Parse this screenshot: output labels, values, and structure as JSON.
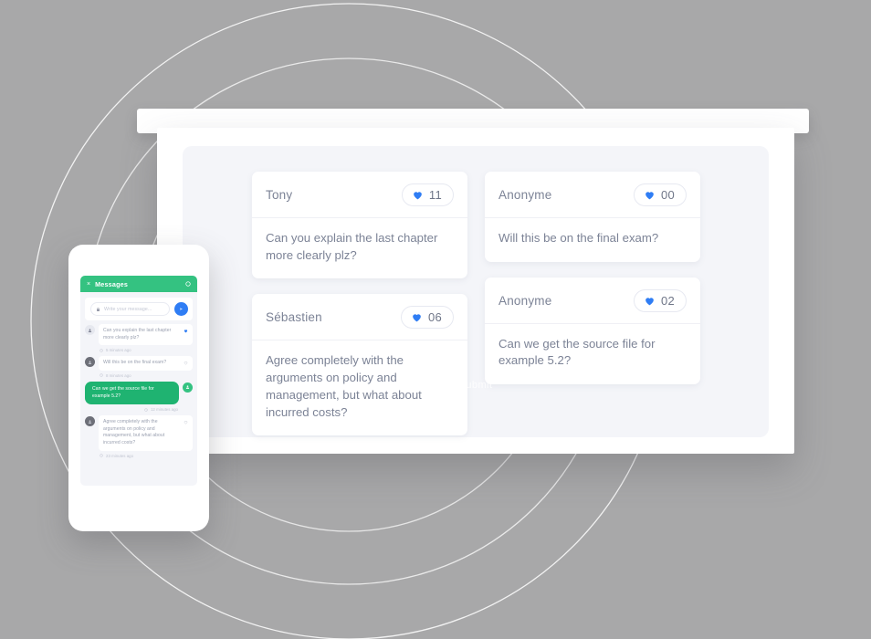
{
  "theme": {
    "background": "#a8a8a9",
    "panel_background": "#f4f5f9",
    "card_background": "#ffffff",
    "accent_blue": "#2f7df4",
    "accent_green": "#34c281",
    "bubble_green": "#1fb371",
    "text_muted": "#7c8396"
  },
  "board": {
    "submit_label": "Submit",
    "columns": [
      {
        "cards": [
          {
            "author": "Tony",
            "likes": "11",
            "message": "Can you explain the last chapter more clearly plz?"
          },
          {
            "author": "Sébastien",
            "likes": "06",
            "message": "Agree completely with the arguments on policy and management, but what about incurred costs?"
          }
        ]
      },
      {
        "cards": [
          {
            "author": "Anonyme",
            "likes": "00",
            "message": "Will this be on the final exam?"
          },
          {
            "author": "Anonyme",
            "likes": "02",
            "message": "Can we get the source file for example 5.2?"
          }
        ]
      }
    ]
  },
  "phone": {
    "header": {
      "close_label": "×",
      "title": "Messages",
      "settings_icon": "gear-icon"
    },
    "composer": {
      "placeholder": "Write your message...",
      "lock_icon": "lock-icon",
      "send_icon": "send-icon"
    },
    "messages": [
      {
        "text": "Can you explain the last chapter more clearly plz?",
        "time": "5 minutes ago",
        "direction": "incoming",
        "avatar": "user-avatar-light",
        "liked": true
      },
      {
        "text": "Will this be on the final exam?",
        "time": "8 minutes ago",
        "direction": "incoming",
        "avatar": "user-avatar-dark",
        "liked": false
      },
      {
        "text": "Can we get the source file for example 5.2?",
        "time": "12 minutes ago",
        "direction": "outgoing",
        "avatar": "user-avatar-green",
        "liked": false
      },
      {
        "text": "Agree completely with the arguments on policy and management, but what about incurred costs?",
        "time": "23 minutes ago",
        "direction": "incoming",
        "avatar": "user-avatar-dark",
        "liked": false
      }
    ]
  }
}
